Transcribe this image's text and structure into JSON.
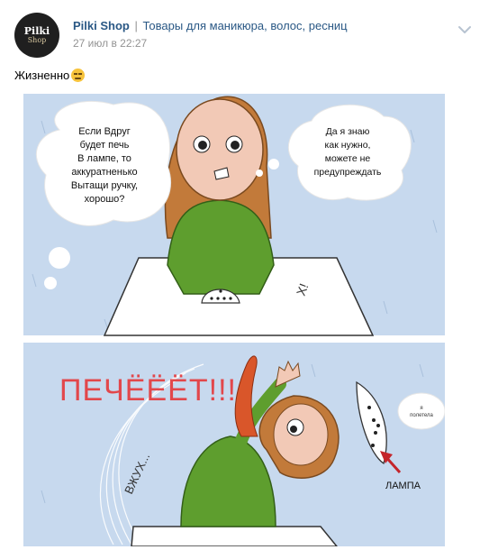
{
  "post": {
    "author_name": "Pilki Shop",
    "author_separator": "|",
    "author_subtitle": "Товары для маникюра, волос, ресниц",
    "date": "27 июл в 22:27",
    "text": "Жизненно",
    "text_emoji": "neutral-face-emoji",
    "avatar": {
      "line1": "Pilki",
      "line2": "Shop"
    }
  },
  "comic": {
    "bubble_left": [
      "Если Вдруг",
      "будет печь",
      "В лампе, то",
      "аккуратненько",
      "Вытащи ручку,",
      "хорошо?"
    ],
    "bubble_right": [
      "Да я знаю",
      "как нужно,",
      "можете не",
      "предупреждать"
    ],
    "shout": "ПЕЧЁЁЁТ!!!",
    "whoosh": "ВЖУХ...",
    "lamp_label": "ЛАМПА",
    "lamp_bubble": [
      "я",
      "полетела"
    ],
    "paper_mark": "Х!"
  },
  "icons": {
    "menu": "chevron-down-icon"
  },
  "colors": {
    "link": "#2a5885",
    "muted": "#939393",
    "sky": "#c7d9ee",
    "shirt": "#5e9e2e",
    "hair": "#c27a3a"
  }
}
